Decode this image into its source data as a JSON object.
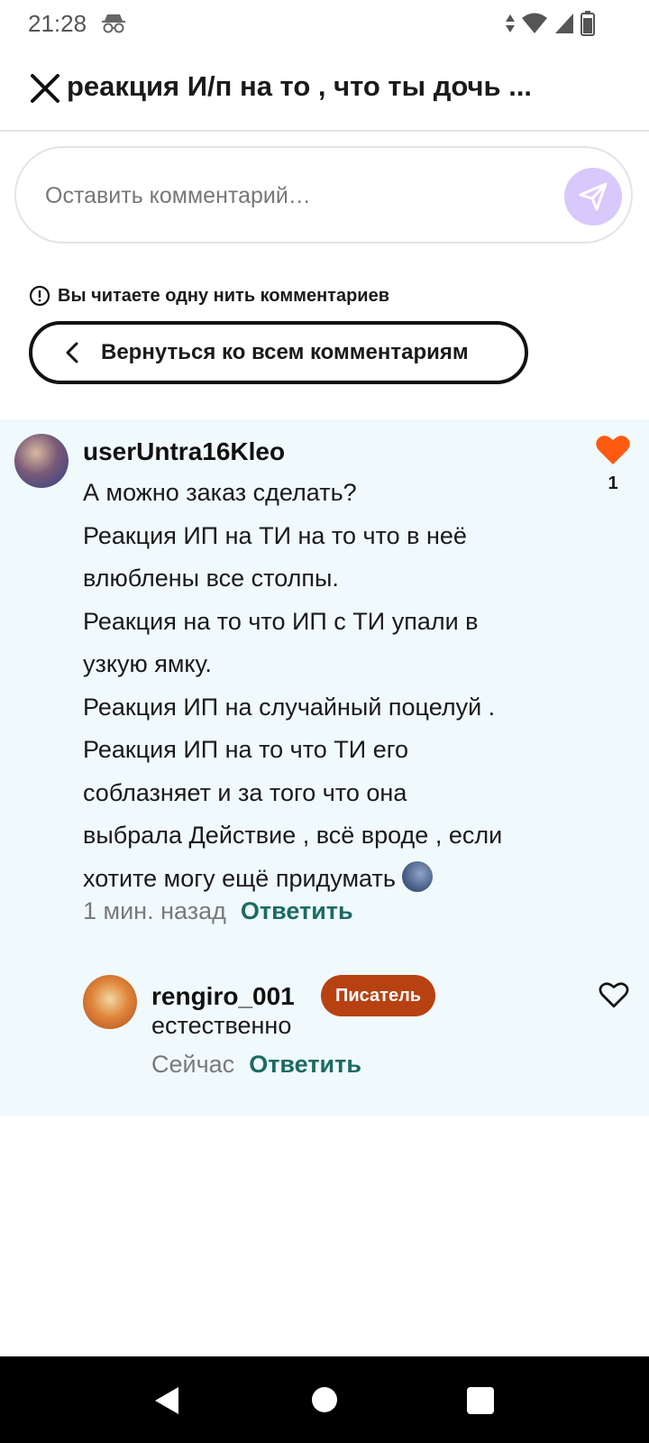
{
  "status_bar": {
    "time": "21:28"
  },
  "header": {
    "title": "реакция И/п на то , что ты дочь ..."
  },
  "comment_input": {
    "placeholder": "Оставить комментарий…"
  },
  "thread_notice": {
    "text": "Вы читаете одну нить комментариев"
  },
  "back_button": {
    "label": "Вернуться ко всем комментариям"
  },
  "comments": [
    {
      "username": "userUntra16Kleo",
      "lines": [
        "А можно заказ сделать?",
        "Реакция ИП на ТИ на то что в неё",
        "влюблены все столпы.",
        "Реакция на то что ИП с ТИ упали в",
        "узкую ямку.",
        "Реакция ИП на случайный поцелуй .",
        "Реакция ИП на то что ТИ его",
        "соблазняет и за того что она",
        "выбрала Действие , всё вроде , если",
        "хотите могу ещё придумать"
      ],
      "emoji_icon": "new-moon-face-emoji",
      "time": "1 мин. назад",
      "reply_label": "Ответить",
      "likes": "1",
      "liked": true
    },
    {
      "username": "rengiro_001",
      "badge": "Писатель",
      "text": "естественно",
      "time": "Сейчас",
      "reply_label": "Ответить",
      "liked": false
    }
  ],
  "colors": {
    "accent_reply": "#1c6a63",
    "like": "#ff5a12",
    "badge": "#b84112",
    "send_button": "#d9c8fb",
    "thread_bg": "#f0f9fb"
  }
}
